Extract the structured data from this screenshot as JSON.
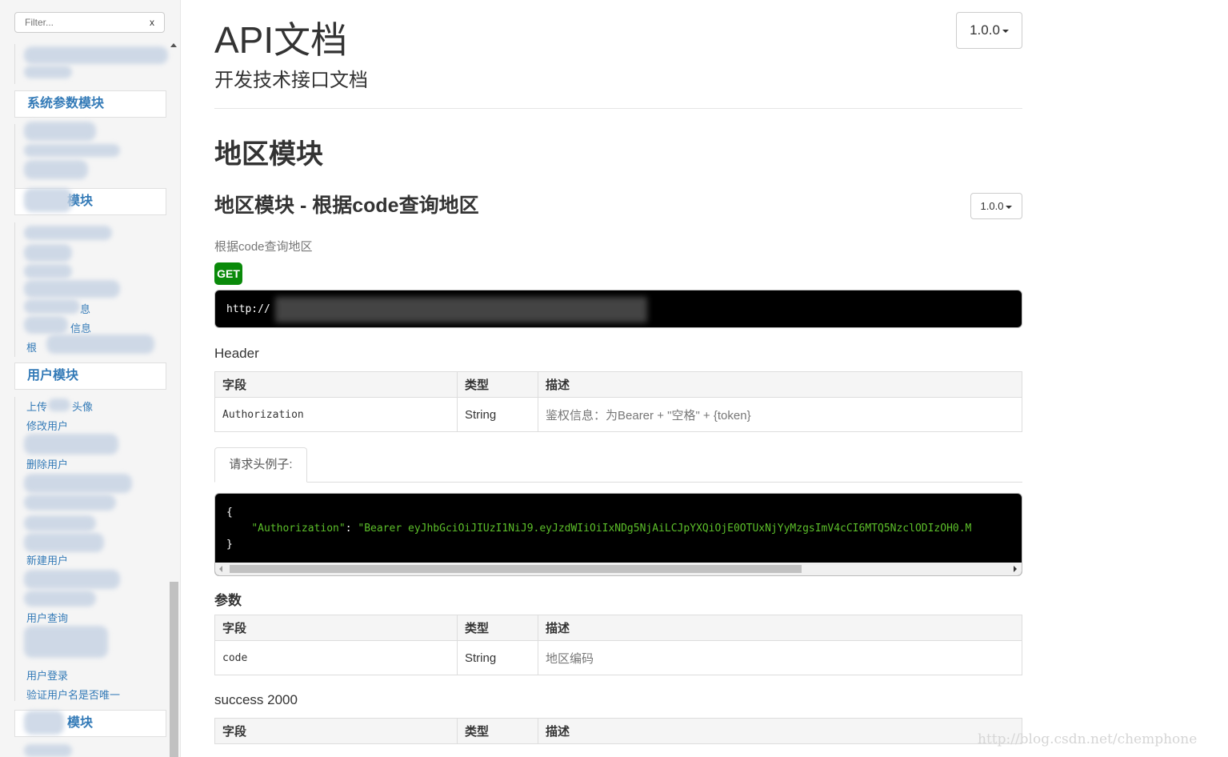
{
  "sidebar": {
    "filter_placeholder": "Filter...",
    "filter_clear": "x",
    "groups": [
      {
        "label": "系统参数模块"
      },
      {
        "label": "模块"
      },
      {
        "label": "用户模块"
      },
      {
        "label": "模块"
      }
    ],
    "items": [
      {
        "label": "息"
      },
      {
        "label": "信息"
      },
      {
        "label": "根"
      },
      {
        "label": "上传"
      },
      {
        "label": "头像"
      },
      {
        "label": "修改用户"
      },
      {
        "label": "删除用户"
      },
      {
        "label": "新建用户"
      },
      {
        "label": "用户查询"
      },
      {
        "label": "用户登录"
      },
      {
        "label": "验证用户名是否唯一"
      }
    ]
  },
  "header": {
    "title": "API文档",
    "subtitle": "开发技术接口文档",
    "version": "1.0.0"
  },
  "section": {
    "title": "地区模块"
  },
  "endpoint": {
    "title": "地区模块 - 根据code查询地区",
    "version": "1.0.0",
    "description": "根据code查询地区",
    "method": "GET",
    "url": "http://"
  },
  "header_params": {
    "label": "Header",
    "columns": [
      "字段",
      "类型",
      "描述"
    ],
    "rows": [
      {
        "field": "Authorization",
        "type": "String",
        "desc": "鉴权信息：为Bearer + \"空格\" + {token}"
      }
    ]
  },
  "example": {
    "tab": "请求头例子:",
    "open": "{",
    "key": "\"Authorization\"",
    "sep": ": ",
    "value": "\"Bearer eyJhbGciOiJIUzI1NiJ9.eyJzdWIiOiIxNDg5NjAiLCJpYXQiOjE0OTUxNjYyMzgsImV4cCI6MTQ5NzclODIzOH0.M",
    "close": "}"
  },
  "params": {
    "label": "参数",
    "columns": [
      "字段",
      "类型",
      "描述"
    ],
    "rows": [
      {
        "field": "code",
        "type": "String",
        "desc": "地区编码"
      }
    ]
  },
  "success": {
    "label": "success 2000",
    "columns": [
      "字段",
      "类型",
      "描述"
    ]
  },
  "watermark": "http://blog.csdn.net/chemphone"
}
